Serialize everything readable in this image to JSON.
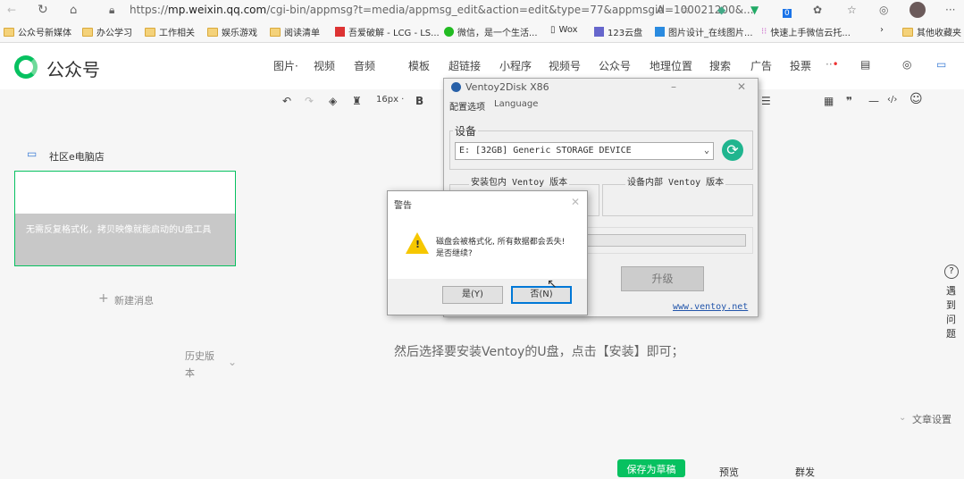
{
  "browser": {
    "url_prefix": "https://",
    "url_host": "mp.weixin.qq.com",
    "url_rest": "/cgi-bin/appmsg?t=media/appmsg_edit&action=edit&type=77&appmsgid=100021200&...",
    "bookmarks": [
      "公众号新媒体",
      "办公学习",
      "工作相关",
      "娱乐游戏",
      "阅读清单",
      "吾爱破解 - LCG - LS...",
      "微信，是一个生活...",
      "Wox",
      "123云盘",
      "图片设计_在线图片...",
      "快速上手微信云托...",
      "其他收藏夹"
    ],
    "badge": "0"
  },
  "header": {
    "logo": "公众号",
    "nav": [
      "图片·",
      "视频",
      "音频",
      "模板",
      "超链接",
      "小程序",
      "视频号",
      "公众号",
      "地理位置",
      "搜索",
      "广告",
      "投票"
    ]
  },
  "toolbar": {
    "font_size": "16px ·",
    "bold": "B"
  },
  "sidebar": {
    "account": "社区e电脑店",
    "article_title": "无需反复格式化，拷贝映像就能启动的U盘工具",
    "new_message": "新建消息",
    "history": "历史版本"
  },
  "editor": {
    "text": "然后选择要安装Ventoy的U盘，点击【安装】即可；",
    "article_settings": "文章设置",
    "help": "遇到问题"
  },
  "footer": {
    "save": "保存为草稿",
    "preview": "预览",
    "send": "群发"
  },
  "ventoy": {
    "title": "Ventoy2Disk  X86",
    "menu": [
      "配置选项",
      "Language"
    ],
    "device_label": "设备",
    "device_value": "E: [32GB] Generic STORAGE DEVICE",
    "pkg_version": "安装包内 Ventoy 版本",
    "dev_version": "设备内部 Ventoy 版本",
    "upgrade": "升级",
    "link": "www.ventoy.net"
  },
  "warning": {
    "title": "警告",
    "message1": "磁盘会被格式化, 所有数据都会丢失!",
    "message2": "是否继续?",
    "yes": "是(Y)",
    "no": "否(N)"
  }
}
